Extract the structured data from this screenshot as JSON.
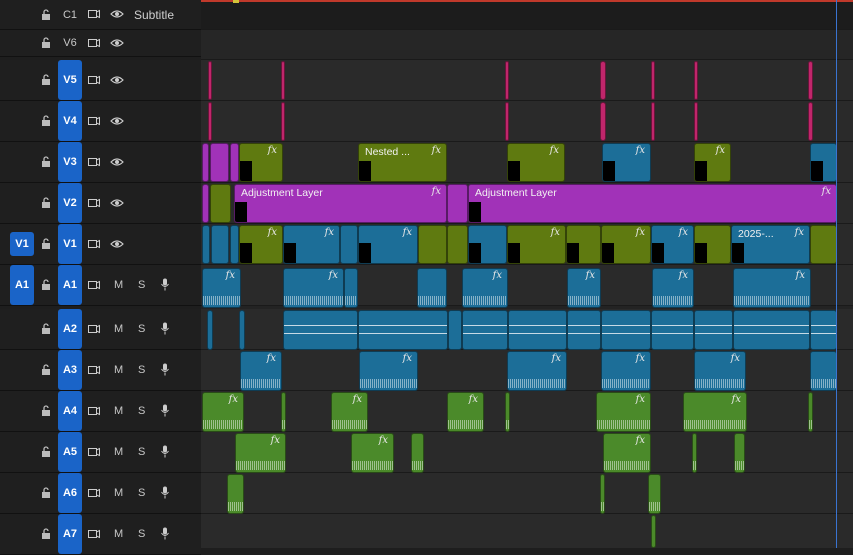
{
  "tracks": {
    "subtitle": {
      "name": "C1",
      "label": "Subtitle"
    },
    "video": [
      {
        "name": "V6",
        "target": false
      },
      {
        "name": "V5",
        "target": true
      },
      {
        "name": "V4",
        "target": true
      },
      {
        "name": "V3",
        "target": true
      },
      {
        "name": "V2",
        "target": true
      },
      {
        "name": "V1",
        "target": true,
        "source": "V1"
      }
    ],
    "audio": [
      {
        "name": "A1",
        "source": "A1"
      },
      {
        "name": "A2"
      },
      {
        "name": "A3"
      },
      {
        "name": "A4"
      },
      {
        "name": "A5"
      },
      {
        "name": "A6"
      },
      {
        "name": "A7"
      }
    ],
    "mute_label": "M",
    "solo_label": "S"
  },
  "clips": {
    "nested_label": "Nested ...",
    "adjustment_label_1": "Adjustment Layer",
    "adjustment_label_2": "Adjustment Layer",
    "dated_label": "2025-...",
    "fx_label": "fx"
  },
  "colors": {
    "track_target": "#1a64c8",
    "clip_pink": "#c0266b",
    "clip_purple": "#a132b8",
    "clip_olive": "#5f7a10",
    "clip_teal": "#1c6e98",
    "clip_green": "#4b8a2a",
    "playhead": "#3a74d1"
  }
}
